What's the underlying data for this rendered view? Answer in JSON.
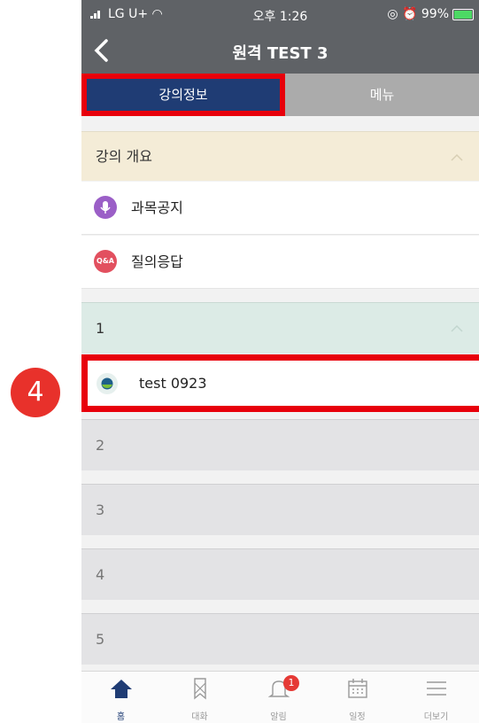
{
  "status": {
    "carrier": "LG U+",
    "time": "오후 1:26",
    "battery": "99%"
  },
  "header": {
    "title": "원격 TEST 3"
  },
  "tabs": [
    {
      "label": "강의정보"
    },
    {
      "label": "메뉴"
    }
  ],
  "overview": {
    "label": "강의 개요"
  },
  "overview_items": [
    {
      "label": "과목공지",
      "icon": "microphone-icon"
    },
    {
      "label": "질의응답",
      "icon_text": "Q&A"
    }
  ],
  "weeks": [
    {
      "label": "1",
      "items": [
        {
          "label": "test 0923"
        }
      ]
    },
    {
      "label": "2"
    },
    {
      "label": "3"
    },
    {
      "label": "4"
    },
    {
      "label": "5"
    }
  ],
  "tabbar": [
    {
      "label": "홈"
    },
    {
      "label": "대화"
    },
    {
      "label": "알림",
      "badge": "1"
    },
    {
      "label": "일정"
    },
    {
      "label": "더보기"
    }
  ],
  "annotation": {
    "step": "4"
  },
  "colors": {
    "header": "#5f6266",
    "tab_active": "#1f3c74",
    "highlight": "#e8000b",
    "overview_bg": "#f4ecd7",
    "week1_bg": "#dcebe6"
  }
}
